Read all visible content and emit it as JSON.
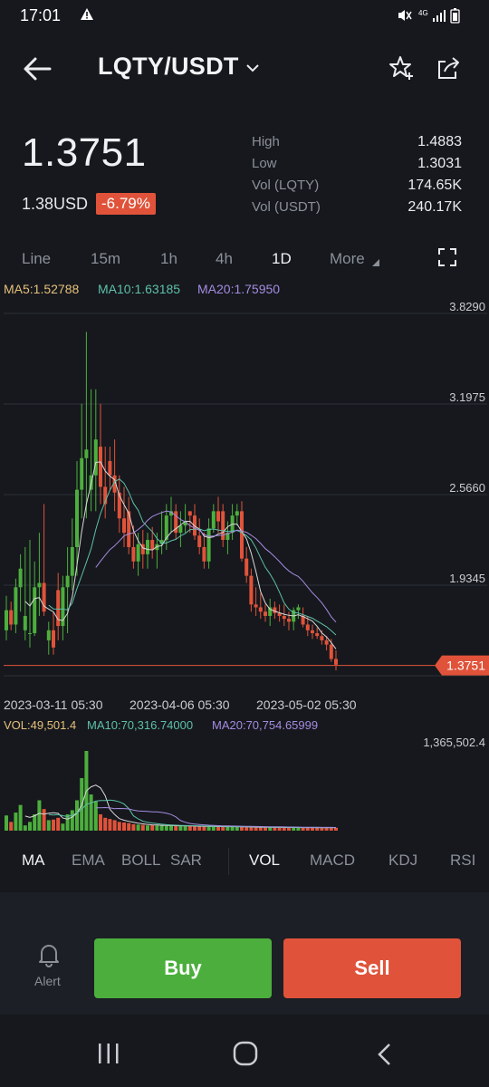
{
  "status_bar": {
    "time": "17:01",
    "network": "4G"
  },
  "header": {
    "pair": "LQTY/USDT"
  },
  "ticker": {
    "price": "1.3751",
    "usd": "1.38USD",
    "change": "-6.79%",
    "stats": [
      {
        "label": "High",
        "value": "1.4883"
      },
      {
        "label": "Low",
        "value": "1.3031"
      },
      {
        "label": "Vol (LQTY)",
        "value": "174.65K"
      },
      {
        "label": "Vol (USDT)",
        "value": "240.17K"
      }
    ]
  },
  "intervals": [
    "Line",
    "15m",
    "1h",
    "4h",
    "1D",
    "More"
  ],
  "active_interval": "1D",
  "ma_legend": {
    "ma5": "MA5:1.52788",
    "ma10": "MA10:1.63185",
    "ma20": "MA20:1.75950"
  },
  "vol_legend": {
    "vol": "VOL:49,501.4",
    "ma10": "MA10:70,316.74000",
    "ma20": "MA20:70,754.65999",
    "max": "1,365,502.4"
  },
  "indicators_left": [
    "MA",
    "EMA",
    "BOLL",
    "SAR"
  ],
  "indicators_right": [
    "VOL",
    "MACD",
    "KDJ",
    "RSI"
  ],
  "actions": {
    "alert": "Alert",
    "buy": "Buy",
    "sell": "Sell"
  },
  "colors": {
    "up": "#4caf3d",
    "down": "#e0533a",
    "ma5": "#e6c07b",
    "ma10": "#5ec0a8",
    "ma20": "#a58be0",
    "background": "#16181d"
  },
  "chart_data": {
    "type": "candlestick",
    "y_ticks": [
      "3.8290",
      "3.1975",
      "2.5660",
      "1.9345",
      "1.3031"
    ],
    "ylim": [
      1.3031,
      3.829
    ],
    "x_tick_labels": [
      "2023-03-11 05:30",
      "2023-04-06 05:30",
      "2023-05-02 05:30"
    ],
    "current_price_label": "1.3751",
    "candles": [
      [
        1.62,
        1.86,
        1.55,
        1.76
      ],
      [
        1.76,
        1.82,
        1.62,
        1.66
      ],
      [
        1.66,
        1.98,
        1.6,
        1.92
      ],
      [
        1.92,
        2.15,
        1.75,
        2.05
      ],
      [
        1.62,
        2.2,
        1.55,
        1.72
      ],
      [
        1.6,
        2.25,
        1.5,
        1.6
      ],
      [
        1.6,
        2.1,
        1.58,
        1.92
      ],
      [
        1.92,
        2.3,
        1.72,
        1.95
      ],
      [
        1.95,
        2.5,
        1.72,
        1.75
      ],
      [
        1.55,
        1.68,
        1.45,
        1.62
      ],
      [
        1.62,
        1.75,
        1.45,
        1.5
      ],
      [
        1.9,
        2.02,
        1.55,
        1.65
      ],
      [
        1.65,
        2.0,
        1.55,
        1.92
      ],
      [
        1.92,
        2.2,
        1.6,
        2.0
      ],
      [
        2.0,
        2.4,
        1.9,
        2.2
      ],
      [
        2.2,
        2.8,
        2.0,
        2.6
      ],
      [
        2.6,
        3.2,
        2.4,
        2.82
      ],
      [
        2.82,
        3.7,
        2.4,
        2.88
      ],
      [
        2.6,
        3.3,
        2.45,
        2.7
      ],
      [
        2.7,
        3.3,
        2.45,
        2.95
      ],
      [
        2.9,
        3.2,
        2.5,
        2.62
      ],
      [
        2.62,
        2.9,
        2.4,
        2.5
      ],
      [
        2.8,
        2.9,
        2.6,
        2.7
      ],
      [
        2.7,
        2.95,
        2.45,
        2.58
      ],
      [
        2.58,
        2.7,
        2.3,
        2.4
      ],
      [
        2.4,
        2.62,
        2.2,
        2.3
      ],
      [
        2.45,
        2.55,
        2.15,
        2.2
      ],
      [
        2.2,
        2.35,
        2.05,
        2.1
      ],
      [
        2.1,
        2.3,
        2.0,
        2.22
      ],
      [
        2.22,
        2.32,
        2.05,
        2.15
      ],
      [
        2.15,
        2.3,
        2.05,
        2.25
      ],
      [
        2.25,
        2.34,
        2.12,
        2.18
      ],
      [
        2.18,
        2.3,
        2.05,
        2.22
      ],
      [
        2.22,
        2.45,
        2.15,
        2.25
      ],
      [
        2.25,
        2.5,
        2.18,
        2.42
      ],
      [
        2.42,
        2.55,
        2.3,
        2.45
      ],
      [
        2.45,
        2.5,
        2.25,
        2.3
      ],
      [
        2.3,
        2.45,
        2.2,
        2.35
      ],
      [
        2.35,
        2.5,
        2.3,
        2.38
      ],
      [
        2.45,
        2.45,
        2.3,
        2.42
      ],
      [
        2.42,
        2.5,
        2.25,
        2.28
      ],
      [
        2.28,
        2.4,
        2.15,
        2.2
      ],
      [
        2.2,
        2.3,
        2.05,
        2.1
      ],
      [
        2.1,
        2.4,
        2.05,
        2.33
      ],
      [
        2.33,
        2.5,
        2.3,
        2.45
      ],
      [
        2.45,
        2.55,
        2.3,
        2.38
      ],
      [
        2.45,
        2.5,
        2.2,
        2.25
      ],
      [
        2.25,
        2.38,
        2.15,
        2.3
      ],
      [
        2.3,
        2.5,
        2.25,
        2.42
      ],
      [
        2.42,
        2.5,
        2.35,
        2.45
      ],
      [
        2.45,
        2.52,
        2.1,
        2.12
      ],
      [
        2.12,
        2.2,
        1.95,
        2.0
      ],
      [
        2.0,
        2.05,
        1.75,
        1.8
      ],
      [
        1.8,
        1.92,
        1.72,
        1.78
      ],
      [
        1.78,
        1.88,
        1.7,
        1.75
      ],
      [
        1.75,
        1.8,
        1.68,
        1.72
      ],
      [
        1.72,
        1.84,
        1.65,
        1.78
      ],
      [
        1.78,
        1.82,
        1.7,
        1.74
      ],
      [
        1.74,
        1.8,
        1.68,
        1.72
      ],
      [
        1.72,
        1.8,
        1.65,
        1.7
      ],
      [
        1.7,
        1.75,
        1.62,
        1.68
      ],
      [
        1.68,
        1.78,
        1.62,
        1.76
      ],
      [
        1.76,
        1.8,
        1.7,
        1.78
      ],
      [
        1.72,
        1.78,
        1.64,
        1.66
      ],
      [
        1.66,
        1.72,
        1.58,
        1.62
      ],
      [
        1.62,
        1.66,
        1.56,
        1.6
      ],
      [
        1.6,
        1.64,
        1.56,
        1.58
      ],
      [
        1.58,
        1.62,
        1.52,
        1.55
      ],
      [
        1.55,
        1.58,
        1.48,
        1.52
      ],
      [
        1.52,
        1.56,
        1.4,
        1.42
      ],
      [
        1.42,
        1.48,
        1.34,
        1.38
      ]
    ],
    "volumes": [
      260000,
      150000,
      310000,
      440000,
      90000,
      150000,
      280000,
      520000,
      370000,
      180000,
      190000,
      220000,
      120000,
      280000,
      350000,
      520000,
      900000,
      1365502.4,
      620000,
      500000,
      280000,
      220000,
      200000,
      180000,
      150000,
      140000,
      130000,
      110000,
      105000,
      100000,
      90000,
      95000,
      90000,
      85000,
      80000,
      90000,
      85000,
      80000,
      75000,
      80000,
      75000,
      70000,
      75000,
      70000,
      65000,
      68000,
      70000,
      72000,
      68000,
      65000,
      62000,
      60000,
      58000,
      55000,
      60000,
      58000,
      56000,
      54000,
      52000,
      55000,
      57000,
      53000,
      52000,
      50000,
      55000,
      53000,
      52000,
      51000,
      50000,
      60000,
      49501.4
    ]
  }
}
